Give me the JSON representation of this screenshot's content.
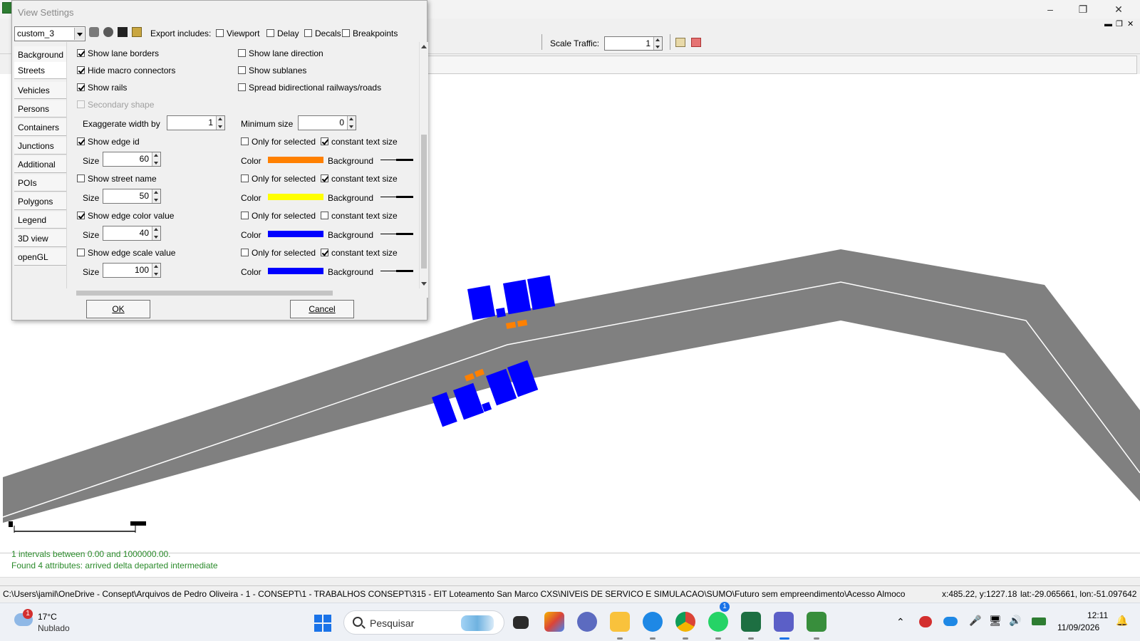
{
  "dialog": {
    "title": "View Settings",
    "scheme": "custom_3",
    "export_label": "Export includes:",
    "export_options": [
      {
        "label": "Viewport",
        "checked": false
      },
      {
        "label": "Delay",
        "checked": false
      },
      {
        "label": "Decals",
        "checked": false
      },
      {
        "label": "Breakpoints",
        "checked": false
      }
    ],
    "tabs": [
      "Background",
      "Streets",
      "Vehicles",
      "Persons",
      "Containers",
      "Junctions",
      "Additional",
      "POIs",
      "Polygons",
      "Legend",
      "3D view",
      "openGL"
    ],
    "active_tab": "Streets",
    "streets": {
      "show_lane_borders": "Show lane borders",
      "hide_macro_connectors": "Hide macro connectors",
      "show_rails": "Show rails",
      "secondary_shape": "Secondary shape",
      "show_lane_direction": "Show lane direction",
      "show_sublanes": "Show sublanes",
      "spread_bidirectional": "Spread bidirectional railways/roads",
      "exaggerate_label": "Exaggerate width by",
      "exaggerate_value": "1",
      "minimum_size_label": "Minimum size",
      "minimum_size_value": "0",
      "text_groups": [
        {
          "label": "Show edge id",
          "checked": true,
          "size": "60",
          "only_selected": false,
          "constant": true,
          "color": "#ff8000"
        },
        {
          "label": "Show street name",
          "checked": false,
          "size": "50",
          "only_selected": false,
          "constant": true,
          "color": "#ffff00"
        },
        {
          "label": "Show edge color value",
          "checked": true,
          "size": "40",
          "only_selected": false,
          "constant": false,
          "color": "#0000ff"
        },
        {
          "label": "Show edge scale value",
          "checked": false,
          "size": "100",
          "only_selected": false,
          "constant": true,
          "color": "#0000ff"
        }
      ],
      "size_label": "Size",
      "only_selected_label": "Only for selected",
      "constant_label": "constant text size",
      "color_label": "Color",
      "background_label": "Background"
    },
    "ok_label": "OK",
    "cancel_label": "Cancel"
  },
  "toolbar": {
    "scale_traffic_label": "Scale Traffic:",
    "scale_traffic_value": "1"
  },
  "messages": [
    "1 intervals between 0.00 and 1000000.00.",
    "Found 4 attributes: arrived delta departed intermediate"
  ],
  "status": {
    "path": "C:\\Users\\jamil\\OneDrive - Consept\\Arquivos de Pedro Oliveira - 1 - CONSEPT\\1 - TRABALHOS CONSEPT\\315 - EIT Loteamento San Marco CXS\\NIVEIS DE SERVICO E SIMULACAO\\SUMO\\Futuro sem empreendimento\\Acesso Almoco",
    "coords": "x:485.22, y:1227.18",
    "geo": "lat:-29.065661, lon:-51.097642"
  },
  "taskbar": {
    "temperature": "17°C",
    "condition": "Nublado",
    "weather_badge": "1",
    "search_placeholder": "Pesquisar",
    "whatsapp_badge": "1",
    "time": "12:11",
    "date": "11/09/2026"
  },
  "colors": {
    "road": "#808080",
    "vehicle": "#0000ff",
    "marker": "#ff8000",
    "message_text": "#2a8a2a"
  }
}
